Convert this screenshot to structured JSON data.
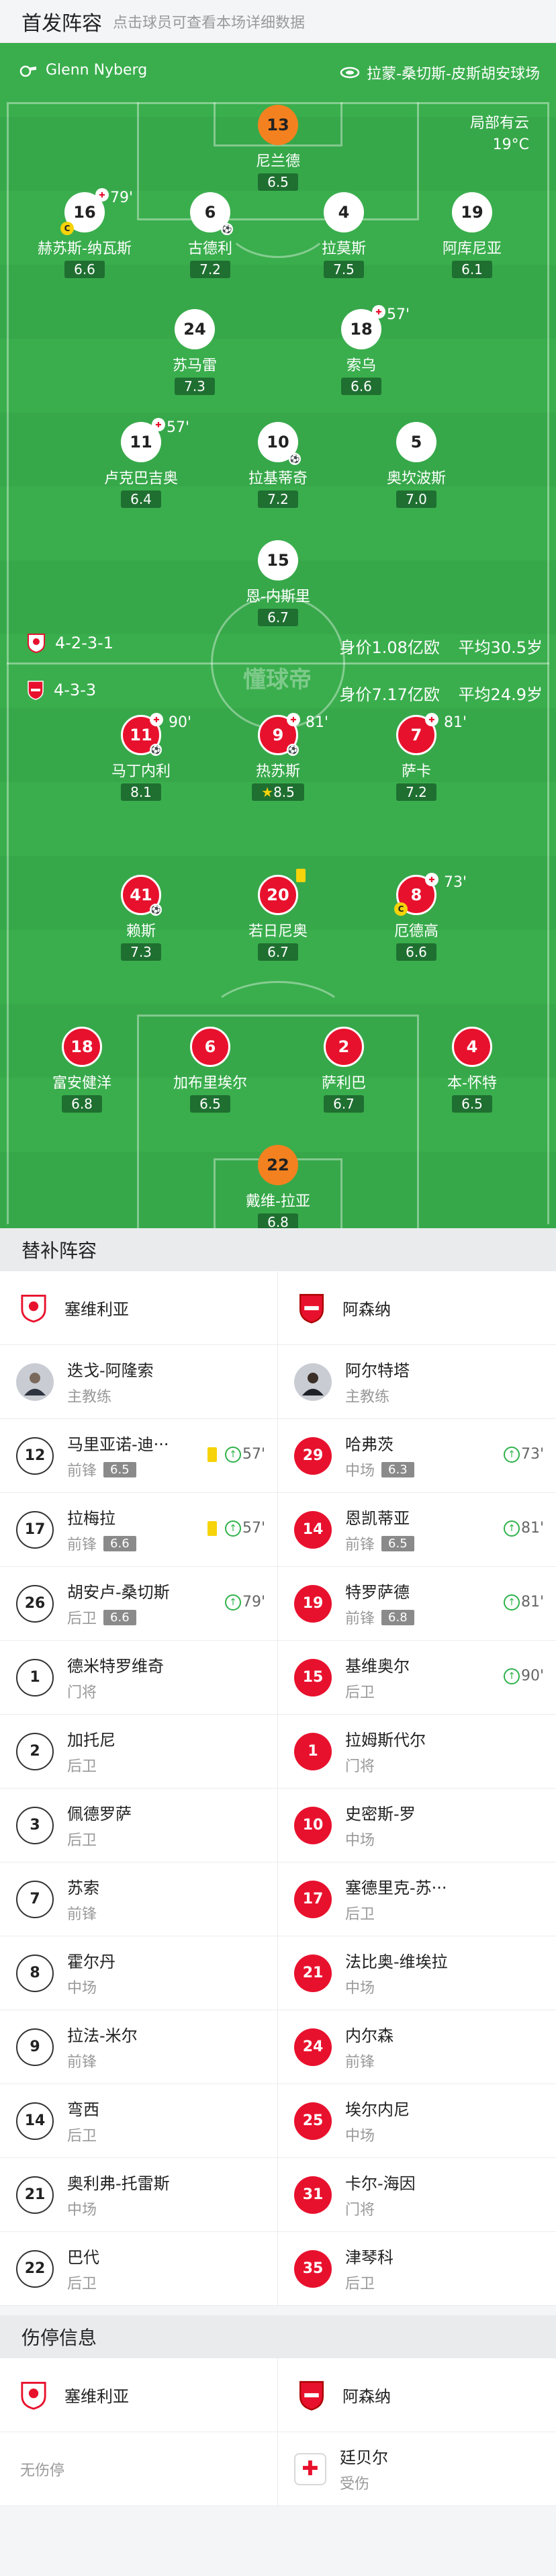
{
  "header": {
    "title": "首发阵容",
    "subtitle": "点击球员可查看本场详细数据"
  },
  "match": {
    "referee": "Glenn Nyberg",
    "stadium": "拉蒙-桑切斯-皮斯胡安球场",
    "weather": "局部有云",
    "temperature": "19°C"
  },
  "watermark": "懂球帝",
  "home_lineup": {
    "formation": "4-2-3-1",
    "value": "身价1.08亿欧",
    "age": "平均30.5岁",
    "players": [
      {
        "num": "13",
        "name": "尼兰德",
        "rating": "6.5"
      },
      {
        "num": "16",
        "name": "赫苏斯-纳瓦斯",
        "rating": "6.6",
        "sub_time": "79'"
      },
      {
        "num": "6",
        "name": "古德利",
        "rating": "7.2"
      },
      {
        "num": "4",
        "name": "拉莫斯",
        "rating": "7.5"
      },
      {
        "num": "19",
        "name": "阿库尼亚",
        "rating": "6.1"
      },
      {
        "num": "24",
        "name": "苏马雷",
        "rating": "7.3"
      },
      {
        "num": "18",
        "name": "索乌",
        "rating": "6.6",
        "sub_time": "57'"
      },
      {
        "num": "11",
        "name": "卢克巴吉奥",
        "rating": "6.4",
        "sub_time": "57'"
      },
      {
        "num": "10",
        "name": "拉基蒂奇",
        "rating": "7.2"
      },
      {
        "num": "5",
        "name": "奥坎波斯",
        "rating": "7.0"
      },
      {
        "num": "15",
        "name": "恩-内斯里",
        "rating": "6.7"
      }
    ]
  },
  "away_lineup": {
    "formation": "4-3-3",
    "value": "身价7.17亿欧",
    "age": "平均24.9岁",
    "players": [
      {
        "num": "11",
        "name": "马丁内利",
        "rating": "8.1",
        "sub_time": "90'"
      },
      {
        "num": "9",
        "name": "热苏斯",
        "rating": "8.5",
        "sub_time": "81'"
      },
      {
        "num": "7",
        "name": "萨卡",
        "rating": "7.2",
        "sub_time": "81'"
      },
      {
        "num": "41",
        "name": "赖斯",
        "rating": "7.3"
      },
      {
        "num": "20",
        "name": "若日尼奥",
        "rating": "6.7"
      },
      {
        "num": "8",
        "name": "厄德高",
        "rating": "6.6",
        "sub_time": "73'"
      },
      {
        "num": "18",
        "name": "富安健洋",
        "rating": "6.8"
      },
      {
        "num": "6",
        "name": "加布里埃尔",
        "rating": "6.5"
      },
      {
        "num": "2",
        "name": "萨利巴",
        "rating": "6.7"
      },
      {
        "num": "4",
        "name": "本-怀特",
        "rating": "6.5"
      },
      {
        "num": "22",
        "name": "戴维-拉亚",
        "rating": "6.8"
      }
    ]
  },
  "subs": {
    "title": "替补阵容",
    "home_team": "塞维利亚",
    "away_team": "阿森纳",
    "home_coach": {
      "name": "迭戈-阿隆索",
      "role": "主教练"
    },
    "away_coach": {
      "name": "阿尔特塔",
      "role": "主教练"
    },
    "rows": [
      {
        "h": {
          "num": "12",
          "name": "马里亚诺-迪···",
          "pos": "前锋",
          "rating": "6.5",
          "time": "57'"
        },
        "a": {
          "num": "29",
          "name": "哈弗茨",
          "pos": "中场",
          "rating": "6.3",
          "time": "73'"
        }
      },
      {
        "h": {
          "num": "17",
          "name": "拉梅拉",
          "pos": "前锋",
          "rating": "6.6",
          "time": "57'"
        },
        "a": {
          "num": "14",
          "name": "恩凯蒂亚",
          "pos": "前锋",
          "rating": "6.5",
          "time": "81'"
        }
      },
      {
        "h": {
          "num": "26",
          "name": "胡安卢-桑切斯",
          "pos": "后卫",
          "rating": "6.6",
          "time": "79'"
        },
        "a": {
          "num": "19",
          "name": "特罗萨德",
          "pos": "前锋",
          "rating": "6.8",
          "time": "81'"
        }
      },
      {
        "h": {
          "num": "1",
          "name": "德米特罗维奇",
          "pos": "门将"
        },
        "a": {
          "num": "15",
          "name": "基维奥尔",
          "pos": "后卫",
          "time": "90'"
        }
      },
      {
        "h": {
          "num": "2",
          "name": "加托尼",
          "pos": "后卫"
        },
        "a": {
          "num": "1",
          "name": "拉姆斯代尔",
          "pos": "门将"
        }
      },
      {
        "h": {
          "num": "3",
          "name": "佩德罗萨",
          "pos": "后卫"
        },
        "a": {
          "num": "10",
          "name": "史密斯-罗",
          "pos": "中场"
        }
      },
      {
        "h": {
          "num": "7",
          "name": "苏索",
          "pos": "前锋"
        },
        "a": {
          "num": "17",
          "name": "塞德里克-苏···",
          "pos": "后卫"
        }
      },
      {
        "h": {
          "num": "8",
          "name": "霍尔丹",
          "pos": "中场"
        },
        "a": {
          "num": "21",
          "name": "法比奥-维埃拉",
          "pos": "中场"
        }
      },
      {
        "h": {
          "num": "9",
          "name": "拉法-米尔",
          "pos": "前锋"
        },
        "a": {
          "num": "24",
          "name": "内尔森",
          "pos": "前锋"
        }
      },
      {
        "h": {
          "num": "14",
          "name": "弯西",
          "pos": "后卫"
        },
        "a": {
          "num": "25",
          "name": "埃尔内尼",
          "pos": "中场"
        }
      },
      {
        "h": {
          "num": "21",
          "name": "奥利弗-托雷斯",
          "pos": "中场"
        },
        "a": {
          "num": "31",
          "name": "卡尔-海因",
          "pos": "门将"
        }
      },
      {
        "h": {
          "num": "22",
          "name": "巴代",
          "pos": "后卫"
        },
        "a": {
          "num": "35",
          "name": "津琴科",
          "pos": "后卫"
        }
      }
    ]
  },
  "injuries": {
    "title": "伤停信息",
    "home_team": "塞维利亚",
    "away_team": "阿森纳",
    "home_none": "无伤停",
    "away_player": {
      "name": "廷贝尔",
      "status": "受伤"
    }
  },
  "colors": {
    "pitch": "#37a84a",
    "home": "#ffffff",
    "away": "#e8112d",
    "keeper": "#f4811f",
    "star": "#f6d30a"
  }
}
